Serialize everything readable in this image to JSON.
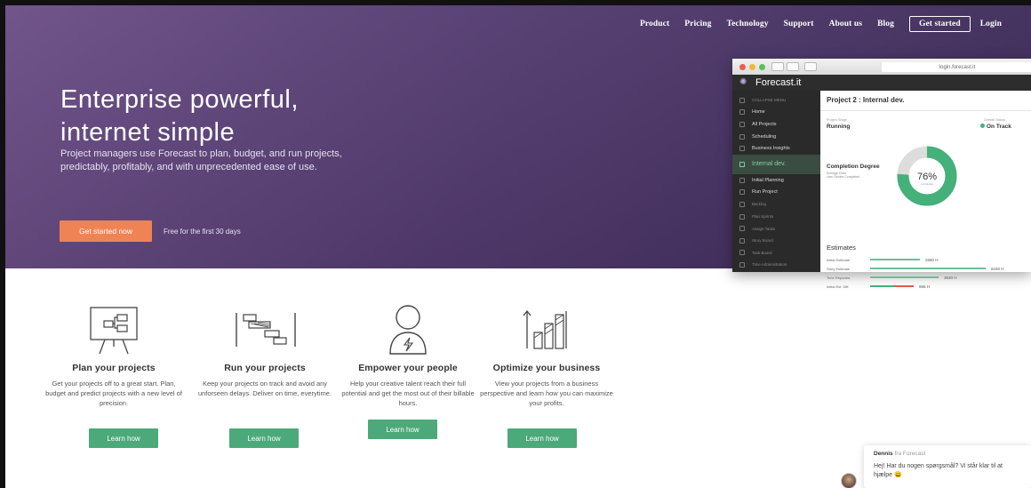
{
  "nav": {
    "items": [
      "Product",
      "Pricing",
      "Technology",
      "Support",
      "About us",
      "Blog"
    ],
    "get_started": "Get started",
    "login": "Login"
  },
  "hero": {
    "title_line1": "Enterprise powerful,",
    "title_line2": "internet simple",
    "description": "Project managers use Forecast to plan, budget, and run projects, predictably, profitably, and with unprecedented ease of use.",
    "cta": "Get started now",
    "free_note": "Free for the first 30 days"
  },
  "mockup": {
    "url": "login.forecast.it",
    "brand": "Forecast.it",
    "sidebar": [
      "COLLAPSE MENU",
      "Home",
      "All Projects",
      "Scheduling",
      "Business Insights",
      "Internal dev.",
      "Initial Planning",
      "Run Project",
      "Backlog",
      "Plan Sprints",
      "Assign Tasks",
      "Story Board",
      "Task Board",
      "Time Administration"
    ],
    "project_title": "Project 2 : Internal dev.",
    "project_stage_label": "Project Stage",
    "project_stage": "Running",
    "overall_status_label": "Overall Status",
    "overall_status": "On Track",
    "completion_title": "Completion Degree",
    "completion_sub1": "Average Done",
    "completion_sub2": "User Stories Completed",
    "completion_value": "76%",
    "completion_fraction": 0.76,
    "donut_caption": "completed",
    "estimates_title": "Estimates",
    "estimates": [
      {
        "label": "Initial Estimate",
        "value": "2660 H",
        "fraction": 0.43
      },
      {
        "label": "Story Estimate",
        "value": "6150 H",
        "fraction": 1.0
      },
      {
        "label": "Time Reported",
        "value": "3630 H",
        "fraction": 0.59
      },
      {
        "label": "Initial Est. Diff.",
        "value": "966 H",
        "fraction": 0.38
      }
    ],
    "colors": {
      "accent": "#44b07a",
      "diff": "#e05a4a"
    }
  },
  "features": [
    {
      "title": "Plan your projects",
      "desc": "Get your projects off to a great start. Plan, budget and predict projects with a new level of precision.",
      "button": "Learn how",
      "icon": "whiteboard-icon"
    },
    {
      "title": "Run your projects",
      "desc": "Keep your projects on track and avoid any unforseen delays. Deliver on time, everytime.",
      "button": "Learn how",
      "icon": "gantt-icon"
    },
    {
      "title": "Empower your people",
      "desc": "Help your creative talent reach their full potential and get the most out of their billable hours.",
      "button": "Learn how",
      "icon": "person-bolt-icon"
    },
    {
      "title": "Optimize your business",
      "desc": "View your projects from a business perspective and learn how you can maximize your profits.",
      "button": "Learn how",
      "icon": "bar-growth-icon"
    }
  ],
  "chat": {
    "name": "Dennis",
    "from": "fra Forecast",
    "message": "Hej! Har du nogen spørgsmål? Vi står klar til at hjælpe 😀"
  },
  "colors": {
    "hero": "#533b70",
    "cta": "#f08355",
    "button": "#4ca97a"
  }
}
